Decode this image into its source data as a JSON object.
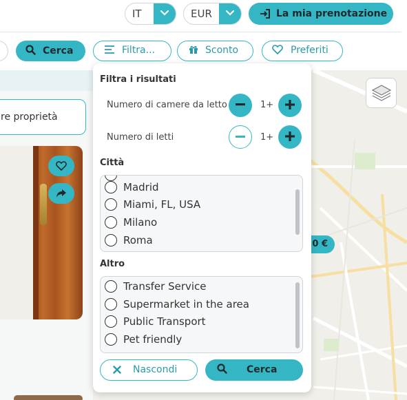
{
  "header": {
    "language": {
      "value": "IT",
      "arrow_icon": "chevron-down-icon"
    },
    "currency": {
      "value": "EUR",
      "arrow_icon": "chevron-down-icon"
    },
    "booking_button": {
      "label": "La mia prenotazione",
      "icon": "login-icon"
    }
  },
  "toolbar": {
    "search_label": "Cerca",
    "filter_label": "Filtra...",
    "discount_label": "Sconto",
    "favorites_label": "Preferiti"
  },
  "listing": {
    "properties_button": "re proprietà"
  },
  "map": {
    "price_pin": "0 €",
    "layers_icon": "layers-icon"
  },
  "filters": {
    "title": "Filtra i risultati",
    "bedrooms": {
      "label": "Numero di camere da letto",
      "value": "1+"
    },
    "beds": {
      "label": "Numero di letti",
      "value": "1+"
    },
    "city": {
      "title": "Città",
      "options": [
        "Madrid",
        "Miami, FL, USA",
        "Milano",
        "Roma"
      ]
    },
    "other": {
      "title": "Altro",
      "options": [
        "Transfer Service",
        "Supermarket in the area",
        "Public Transport",
        "Pet friendly"
      ]
    },
    "hide_label": "Nascondi",
    "search_label": "Cerca"
  },
  "colors": {
    "accent": "#35b6c5",
    "accent_text": "#2a9aab",
    "map_background": "#f0efe9"
  }
}
